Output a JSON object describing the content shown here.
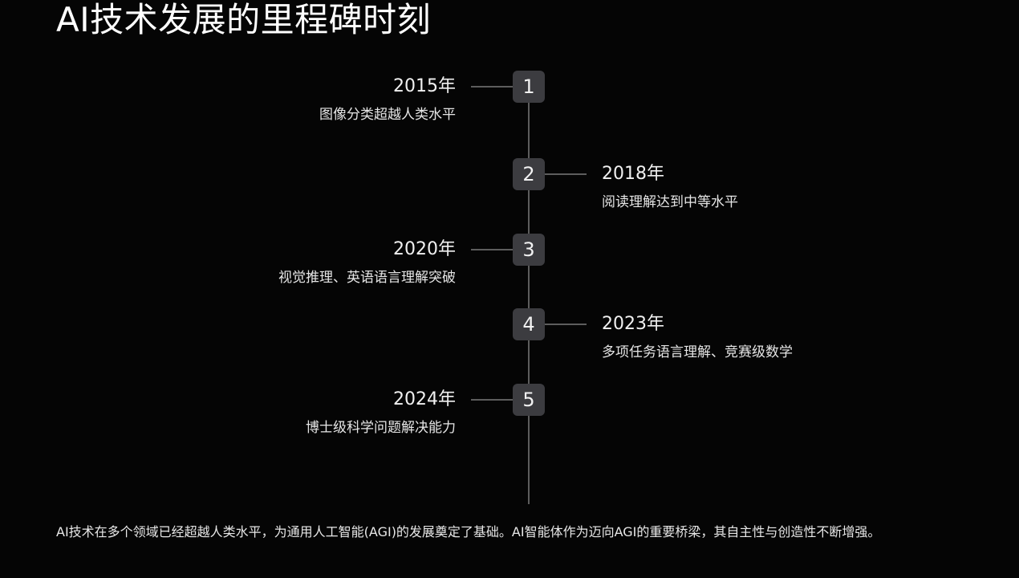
{
  "title": "AI技术发展的里程碑时刻",
  "milestones": [
    {
      "number": "1",
      "year": "2015年",
      "description": "图像分类超越人类水平",
      "side": "left"
    },
    {
      "number": "2",
      "year": "2018年",
      "description": "阅读理解达到中等水平",
      "side": "right"
    },
    {
      "number": "3",
      "year": "2020年",
      "description": "视觉推理、英语语言理解突破",
      "side": "left"
    },
    {
      "number": "4",
      "year": "2023年",
      "description": "多项任务语言理解、竞赛级数学",
      "side": "right"
    },
    {
      "number": "5",
      "year": "2024年",
      "description": "博士级科学问题解决能力",
      "side": "left"
    }
  ],
  "footer": "AI技术在多个领域已经超越人类水平，为通用人工智能(AGI)的发展奠定了基础。AI智能体作为迈向AGI的重要桥梁，其自主性与创造性不断增强。",
  "colors": {
    "background": "#050505",
    "node": "#3c3c40",
    "line": "#5d5d5d",
    "text": "#ffffff"
  }
}
